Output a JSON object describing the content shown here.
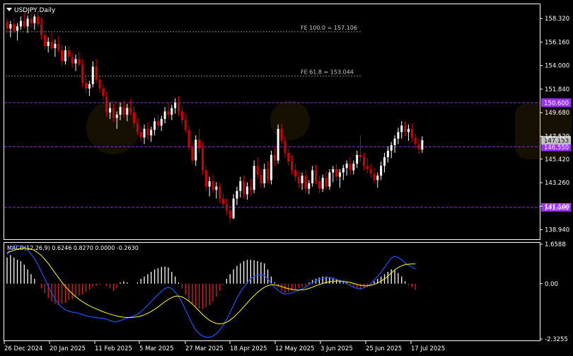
{
  "window": {
    "symbol_title": "USDJPY,Daily",
    "dropdown_icon": "triangle-down-icon"
  },
  "colors": {
    "background": "#000000",
    "frame": "#ffffff",
    "bull_body": "#ffffff",
    "bear_body": "#d40000",
    "purple_level": "#8a2be2",
    "level_tag_bg": "#9b30ff",
    "dotted_level": "#808080",
    "macd_hist_pos": "#ffffff",
    "macd_hist_neg": "#e02020",
    "macd_line": "#2050ff",
    "signal_line": "#ffff00",
    "current_price_tag": "#c0c0c0"
  },
  "price_panel": {
    "y_ticks": [
      "158.320",
      "156.160",
      "154.000",
      "151.840",
      "149.680",
      "147.520",
      "145.420",
      "143.260",
      "141.100",
      "138.940"
    ],
    "current_price_label": "147.153",
    "fib_levels": [
      {
        "label": "FE 100.0 = 157.106",
        "price": 157.106
      },
      {
        "label": "FE 61.8 = 153.044",
        "price": 153.044
      }
    ],
    "horizontal_levels": [
      {
        "label": "150.600",
        "price": 150.6
      },
      {
        "label": "146.550",
        "price": 146.55
      },
      {
        "label": "141.000",
        "price": 141.0
      }
    ]
  },
  "macd_panel": {
    "title": "MACD(12,26,9) 0.6246 0.8270 0.0000 -0.2630",
    "y_ticks": [
      "1.6588",
      "0.00",
      "-2.3255"
    ]
  },
  "x_axis_labels": [
    "26 Dec 2024",
    "20 Jan 2025",
    "11 Feb 2025",
    "5 Mar 2025",
    "27 Mar 2025",
    "18 Apr 2025",
    "12 May 2025",
    "3 Jun 2025",
    "25 Jun 2025",
    "17 Jul 2025"
  ],
  "chart_data": {
    "type": "candlestick",
    "title": "USDJPY,Daily",
    "ylim": [
      138.2,
      159.5
    ],
    "bars": [
      {
        "o": 158.0,
        "h": 158.3,
        "l": 157.0,
        "c": 157.4
      },
      {
        "o": 157.4,
        "h": 158.1,
        "l": 156.6,
        "c": 157.8
      },
      {
        "o": 157.8,
        "h": 158.4,
        "l": 157.0,
        "c": 157.2
      },
      {
        "o": 157.2,
        "h": 157.9,
        "l": 156.3,
        "c": 157.6
      },
      {
        "o": 157.6,
        "h": 158.5,
        "l": 157.3,
        "c": 158.1
      },
      {
        "o": 158.1,
        "h": 158.9,
        "l": 157.4,
        "c": 157.6
      },
      {
        "o": 157.6,
        "h": 158.6,
        "l": 157.0,
        "c": 158.3
      },
      {
        "o": 158.3,
        "h": 158.8,
        "l": 157.5,
        "c": 157.9
      },
      {
        "o": 157.9,
        "h": 158.7,
        "l": 157.3,
        "c": 158.5
      },
      {
        "o": 158.5,
        "h": 159.0,
        "l": 157.6,
        "c": 157.8
      },
      {
        "o": 157.8,
        "h": 158.4,
        "l": 156.4,
        "c": 156.8
      },
      {
        "o": 156.8,
        "h": 157.2,
        "l": 155.5,
        "c": 155.8
      },
      {
        "o": 155.8,
        "h": 156.6,
        "l": 155.2,
        "c": 156.2
      },
      {
        "o": 156.2,
        "h": 157.0,
        "l": 155.4,
        "c": 155.6
      },
      {
        "o": 155.6,
        "h": 156.4,
        "l": 154.8,
        "c": 156.0
      },
      {
        "o": 156.0,
        "h": 156.7,
        "l": 155.2,
        "c": 155.4
      },
      {
        "o": 155.4,
        "h": 155.9,
        "l": 154.0,
        "c": 154.4
      },
      {
        "o": 154.4,
        "h": 155.8,
        "l": 154.1,
        "c": 155.4
      },
      {
        "o": 155.4,
        "h": 155.8,
        "l": 154.5,
        "c": 154.8
      },
      {
        "o": 154.8,
        "h": 155.2,
        "l": 153.8,
        "c": 154.2
      },
      {
        "o": 154.2,
        "h": 155.0,
        "l": 153.5,
        "c": 154.6
      },
      {
        "o": 154.6,
        "h": 155.3,
        "l": 153.9,
        "c": 154.1
      },
      {
        "o": 154.1,
        "h": 154.6,
        "l": 152.0,
        "c": 152.4
      },
      {
        "o": 152.4,
        "h": 153.2,
        "l": 151.5,
        "c": 151.9
      },
      {
        "o": 151.9,
        "h": 152.6,
        "l": 151.2,
        "c": 152.3
      },
      {
        "o": 152.3,
        "h": 154.4,
        "l": 152.0,
        "c": 153.9
      },
      {
        "o": 153.9,
        "h": 154.6,
        "l": 152.4,
        "c": 152.7
      },
      {
        "o": 152.7,
        "h": 153.0,
        "l": 151.5,
        "c": 151.9
      },
      {
        "o": 151.9,
        "h": 152.3,
        "l": 150.8,
        "c": 151.2
      },
      {
        "o": 151.2,
        "h": 151.6,
        "l": 149.3,
        "c": 149.7
      },
      {
        "o": 149.7,
        "h": 150.6,
        "l": 149.1,
        "c": 150.1
      },
      {
        "o": 150.1,
        "h": 150.5,
        "l": 148.8,
        "c": 149.2
      },
      {
        "o": 149.2,
        "h": 149.8,
        "l": 148.2,
        "c": 149.5
      },
      {
        "o": 149.5,
        "h": 150.6,
        "l": 149.0,
        "c": 150.2
      },
      {
        "o": 150.2,
        "h": 150.8,
        "l": 149.2,
        "c": 149.5
      },
      {
        "o": 149.5,
        "h": 150.5,
        "l": 148.9,
        "c": 150.1
      },
      {
        "o": 150.1,
        "h": 150.9,
        "l": 149.4,
        "c": 149.7
      },
      {
        "o": 149.7,
        "h": 150.3,
        "l": 148.3,
        "c": 148.7
      },
      {
        "o": 148.7,
        "h": 149.2,
        "l": 147.6,
        "c": 147.9
      },
      {
        "o": 147.9,
        "h": 148.4,
        "l": 147.0,
        "c": 147.4
      },
      {
        "o": 147.4,
        "h": 148.6,
        "l": 146.8,
        "c": 148.2
      },
      {
        "o": 148.2,
        "h": 148.8,
        "l": 147.2,
        "c": 147.6
      },
      {
        "o": 147.6,
        "h": 148.4,
        "l": 147.0,
        "c": 148.1
      },
      {
        "o": 148.1,
        "h": 149.2,
        "l": 147.6,
        "c": 148.9
      },
      {
        "o": 148.9,
        "h": 149.5,
        "l": 148.1,
        "c": 148.5
      },
      {
        "o": 148.5,
        "h": 149.4,
        "l": 148.0,
        "c": 149.1
      },
      {
        "o": 149.1,
        "h": 150.2,
        "l": 148.7,
        "c": 149.8
      },
      {
        "o": 149.8,
        "h": 150.6,
        "l": 149.1,
        "c": 149.5
      },
      {
        "o": 149.5,
        "h": 150.4,
        "l": 149.0,
        "c": 150.1
      },
      {
        "o": 150.1,
        "h": 151.0,
        "l": 149.6,
        "c": 150.6
      },
      {
        "o": 150.6,
        "h": 151.2,
        "l": 149.4,
        "c": 149.8
      },
      {
        "o": 149.8,
        "h": 150.3,
        "l": 148.6,
        "c": 149.0
      },
      {
        "o": 149.0,
        "h": 149.6,
        "l": 147.8,
        "c": 148.1
      },
      {
        "o": 148.1,
        "h": 148.5,
        "l": 146.2,
        "c": 146.5
      },
      {
        "o": 146.5,
        "h": 147.0,
        "l": 145.0,
        "c": 145.3
      },
      {
        "o": 145.3,
        "h": 147.6,
        "l": 144.8,
        "c": 147.2
      },
      {
        "o": 147.2,
        "h": 148.2,
        "l": 146.0,
        "c": 146.4
      },
      {
        "o": 146.4,
        "h": 147.0,
        "l": 144.0,
        "c": 144.4
      },
      {
        "o": 144.4,
        "h": 144.8,
        "l": 142.5,
        "c": 142.9
      },
      {
        "o": 142.9,
        "h": 143.8,
        "l": 142.0,
        "c": 143.4
      },
      {
        "o": 143.4,
        "h": 144.0,
        "l": 142.3,
        "c": 142.6
      },
      {
        "o": 142.6,
        "h": 143.3,
        "l": 141.8,
        "c": 142.9
      },
      {
        "o": 142.9,
        "h": 143.2,
        "l": 141.4,
        "c": 141.8
      },
      {
        "o": 141.8,
        "h": 142.3,
        "l": 140.9,
        "c": 141.3
      },
      {
        "o": 141.3,
        "h": 141.8,
        "l": 140.3,
        "c": 140.7
      },
      {
        "o": 140.7,
        "h": 141.3,
        "l": 139.6,
        "c": 140.0
      },
      {
        "o": 140.0,
        "h": 142.2,
        "l": 139.9,
        "c": 141.8
      },
      {
        "o": 141.8,
        "h": 142.9,
        "l": 141.2,
        "c": 142.5
      },
      {
        "o": 142.5,
        "h": 143.8,
        "l": 141.9,
        "c": 143.4
      },
      {
        "o": 143.4,
        "h": 143.9,
        "l": 141.8,
        "c": 142.2
      },
      {
        "o": 142.2,
        "h": 143.3,
        "l": 141.7,
        "c": 142.9
      },
      {
        "o": 142.9,
        "h": 143.6,
        "l": 142.1,
        "c": 142.6
      },
      {
        "o": 142.6,
        "h": 145.3,
        "l": 142.3,
        "c": 144.8
      },
      {
        "o": 144.8,
        "h": 145.6,
        "l": 143.6,
        "c": 144.0
      },
      {
        "o": 144.0,
        "h": 144.5,
        "l": 142.8,
        "c": 143.2
      },
      {
        "o": 143.2,
        "h": 145.0,
        "l": 142.8,
        "c": 144.5
      },
      {
        "o": 144.5,
        "h": 145.2,
        "l": 143.2,
        "c": 143.5
      },
      {
        "o": 143.5,
        "h": 146.2,
        "l": 143.1,
        "c": 145.8
      },
      {
        "o": 145.8,
        "h": 146.5,
        "l": 144.8,
        "c": 145.3
      },
      {
        "o": 145.3,
        "h": 148.6,
        "l": 145.0,
        "c": 148.2
      },
      {
        "o": 148.2,
        "h": 148.7,
        "l": 146.8,
        "c": 147.1
      },
      {
        "o": 147.1,
        "h": 147.5,
        "l": 145.6,
        "c": 146.0
      },
      {
        "o": 146.0,
        "h": 146.4,
        "l": 144.8,
        "c": 145.2
      },
      {
        "o": 145.2,
        "h": 145.8,
        "l": 144.0,
        "c": 144.4
      },
      {
        "o": 144.4,
        "h": 145.0,
        "l": 143.4,
        "c": 143.8
      },
      {
        "o": 143.8,
        "h": 144.3,
        "l": 142.8,
        "c": 143.2
      },
      {
        "o": 143.2,
        "h": 144.2,
        "l": 142.6,
        "c": 143.9
      },
      {
        "o": 143.9,
        "h": 144.4,
        "l": 142.3,
        "c": 142.7
      },
      {
        "o": 142.7,
        "h": 143.5,
        "l": 142.2,
        "c": 143.2
      },
      {
        "o": 143.2,
        "h": 144.8,
        "l": 142.9,
        "c": 144.4
      },
      {
        "o": 144.4,
        "h": 144.9,
        "l": 143.1,
        "c": 143.4
      },
      {
        "o": 143.4,
        "h": 143.9,
        "l": 142.3,
        "c": 142.7
      },
      {
        "o": 142.7,
        "h": 144.0,
        "l": 142.4,
        "c": 143.7
      },
      {
        "o": 143.7,
        "h": 144.3,
        "l": 142.6,
        "c": 142.9
      },
      {
        "o": 142.9,
        "h": 144.5,
        "l": 142.6,
        "c": 144.2
      },
      {
        "o": 144.2,
        "h": 144.8,
        "l": 143.3,
        "c": 144.5
      },
      {
        "o": 144.5,
        "h": 145.0,
        "l": 143.4,
        "c": 143.8
      },
      {
        "o": 143.8,
        "h": 144.5,
        "l": 142.8,
        "c": 144.2
      },
      {
        "o": 144.2,
        "h": 144.9,
        "l": 143.5,
        "c": 144.6
      },
      {
        "o": 144.6,
        "h": 145.3,
        "l": 143.9,
        "c": 145.0
      },
      {
        "o": 145.0,
        "h": 145.6,
        "l": 144.0,
        "c": 144.4
      },
      {
        "o": 144.4,
        "h": 145.3,
        "l": 144.0,
        "c": 145.0
      },
      {
        "o": 145.0,
        "h": 146.2,
        "l": 144.6,
        "c": 145.8
      },
      {
        "o": 145.8,
        "h": 147.6,
        "l": 145.2,
        "c": 145.6
      },
      {
        "o": 145.6,
        "h": 146.0,
        "l": 144.4,
        "c": 144.8
      },
      {
        "o": 144.8,
        "h": 145.5,
        "l": 144.1,
        "c": 144.5
      },
      {
        "o": 144.5,
        "h": 145.0,
        "l": 143.7,
        "c": 144.1
      },
      {
        "o": 144.1,
        "h": 144.6,
        "l": 143.2,
        "c": 143.5
      },
      {
        "o": 143.5,
        "h": 144.2,
        "l": 142.8,
        "c": 143.9
      },
      {
        "o": 143.9,
        "h": 145.2,
        "l": 143.5,
        "c": 144.8
      },
      {
        "o": 144.8,
        "h": 146.0,
        "l": 144.2,
        "c": 145.6
      },
      {
        "o": 145.6,
        "h": 146.6,
        "l": 145.1,
        "c": 146.2
      },
      {
        "o": 146.2,
        "h": 147.0,
        "l": 145.5,
        "c": 146.7
      },
      {
        "o": 146.7,
        "h": 147.6,
        "l": 146.0,
        "c": 147.3
      },
      {
        "o": 147.3,
        "h": 148.3,
        "l": 146.8,
        "c": 147.9
      },
      {
        "o": 147.9,
        "h": 148.9,
        "l": 147.3,
        "c": 148.5
      },
      {
        "o": 148.5,
        "h": 148.9,
        "l": 147.5,
        "c": 147.9
      },
      {
        "o": 147.9,
        "h": 148.6,
        "l": 147.1,
        "c": 148.2
      },
      {
        "o": 148.2,
        "h": 148.7,
        "l": 147.0,
        "c": 147.4
      },
      {
        "o": 147.4,
        "h": 147.8,
        "l": 146.4,
        "c": 146.8
      },
      {
        "o": 146.8,
        "h": 147.3,
        "l": 145.9,
        "c": 146.3
      },
      {
        "o": 146.3,
        "h": 147.5,
        "l": 146.0,
        "c": 147.15
      }
    ],
    "macd": {
      "histogram": [
        1.1,
        1.2,
        1.1,
        1.0,
        0.95,
        0.8,
        0.6,
        0.4,
        0.2,
        0.0,
        -0.2,
        -0.4,
        -0.6,
        -0.75,
        -0.85,
        -0.9,
        -0.85,
        -0.8,
        -0.7,
        -0.65,
        -0.55,
        -0.5,
        -0.45,
        -0.35,
        -0.25,
        -0.15,
        -0.1,
        -0.05,
        0.0,
        -0.1,
        -0.2,
        -0.3,
        -0.2,
        0.05,
        0.1,
        0.05,
        0.0,
        0.0,
        0.05,
        0.2,
        0.3,
        0.4,
        0.5,
        0.6,
        0.65,
        0.7,
        0.72,
        0.68,
        0.5,
        0.3,
        0.05,
        -0.2,
        -0.45,
        -0.7,
        -0.85,
        -0.95,
        -1.05,
        -1.05,
        -1.0,
        -0.9,
        -0.75,
        -0.55,
        -0.3,
        -0.05,
        0.2,
        0.4,
        0.6,
        0.75,
        0.85,
        0.95,
        1.0,
        1.0,
        0.98,
        0.95,
        0.9,
        0.85,
        0.6,
        0.3,
        0.05,
        -0.15,
        -0.3,
        -0.4,
        -0.35,
        -0.3,
        -0.25,
        -0.2,
        -0.15,
        -0.1,
        0.05,
        0.15,
        0.2,
        0.25,
        0.3,
        0.3,
        0.28,
        0.25,
        0.2,
        0.15,
        0.1,
        0.05,
        -0.05,
        -0.15,
        -0.2,
        -0.25,
        -0.2,
        -0.15,
        -0.05,
        0.1,
        0.2,
        0.3,
        0.4,
        0.5,
        0.6,
        0.55,
        0.45,
        0.3,
        0.1,
        -0.05,
        -0.15,
        -0.26
      ],
      "macd_line": [
        1.2,
        1.5,
        1.6,
        1.6,
        1.55,
        1.5,
        1.4,
        1.25,
        1.05,
        0.8,
        0.5,
        0.2,
        -0.1,
        -0.4,
        -0.65,
        -0.85,
        -1.0,
        -1.1,
        -1.15,
        -1.2,
        -1.22,
        -1.25,
        -1.3,
        -1.35,
        -1.38,
        -1.4,
        -1.42,
        -1.45,
        -1.45,
        -1.5,
        -1.55,
        -1.6,
        -1.6,
        -1.55,
        -1.5,
        -1.45,
        -1.4,
        -1.35,
        -1.28,
        -1.18,
        -1.05,
        -0.9,
        -0.75,
        -0.6,
        -0.45,
        -0.32,
        -0.2,
        -0.15,
        -0.2,
        -0.35,
        -0.55,
        -0.8,
        -1.1,
        -1.4,
        -1.7,
        -1.95,
        -2.1,
        -2.2,
        -2.25,
        -2.25,
        -2.2,
        -2.1,
        -1.95,
        -1.75,
        -1.5,
        -1.2,
        -0.9,
        -0.6,
        -0.35,
        -0.15,
        0.05,
        0.2,
        0.3,
        0.35,
        0.38,
        0.35,
        0.2,
        0.0,
        -0.15,
        -0.28,
        -0.38,
        -0.45,
        -0.42,
        -0.38,
        -0.33,
        -0.28,
        -0.22,
        -0.15,
        -0.05,
        0.05,
        0.12,
        0.18,
        0.22,
        0.25,
        0.25,
        0.22,
        0.18,
        0.12,
        0.06,
        0.0,
        -0.08,
        -0.15,
        -0.2,
        -0.22,
        -0.18,
        -0.1,
        0.0,
        0.15,
        0.3,
        0.48,
        0.68,
        0.88,
        1.08,
        1.15,
        1.1,
        1.0,
        0.88,
        0.78,
        0.7,
        0.62
      ],
      "signal_line": [
        1.3,
        1.35,
        1.4,
        1.45,
        1.48,
        1.5,
        1.48,
        1.45,
        1.4,
        1.3,
        1.18,
        1.02,
        0.85,
        0.65,
        0.45,
        0.25,
        0.05,
        -0.12,
        -0.28,
        -0.42,
        -0.55,
        -0.66,
        -0.76,
        -0.85,
        -0.93,
        -1.0,
        -1.06,
        -1.12,
        -1.18,
        -1.23,
        -1.28,
        -1.32,
        -1.36,
        -1.39,
        -1.41,
        -1.42,
        -1.42,
        -1.41,
        -1.39,
        -1.36,
        -1.31,
        -1.25,
        -1.17,
        -1.08,
        -0.98,
        -0.87,
        -0.76,
        -0.66,
        -0.58,
        -0.53,
        -0.52,
        -0.56,
        -0.63,
        -0.73,
        -0.86,
        -1.0,
        -1.15,
        -1.3,
        -1.43,
        -1.54,
        -1.62,
        -1.67,
        -1.69,
        -1.67,
        -1.62,
        -1.53,
        -1.42,
        -1.28,
        -1.13,
        -0.97,
        -0.81,
        -0.65,
        -0.5,
        -0.37,
        -0.25,
        -0.15,
        -0.08,
        -0.05,
        -0.05,
        -0.08,
        -0.12,
        -0.17,
        -0.21,
        -0.24,
        -0.26,
        -0.27,
        -0.26,
        -0.24,
        -0.2,
        -0.15,
        -0.09,
        -0.04,
        0.01,
        0.05,
        0.08,
        0.1,
        0.11,
        0.11,
        0.1,
        0.08,
        0.05,
        0.01,
        -0.03,
        -0.07,
        -0.09,
        -0.09,
        -0.07,
        -0.03,
        0.03,
        0.11,
        0.2,
        0.32,
        0.45,
        0.58,
        0.68,
        0.75,
        0.8,
        0.82,
        0.83,
        0.83
      ]
    }
  }
}
